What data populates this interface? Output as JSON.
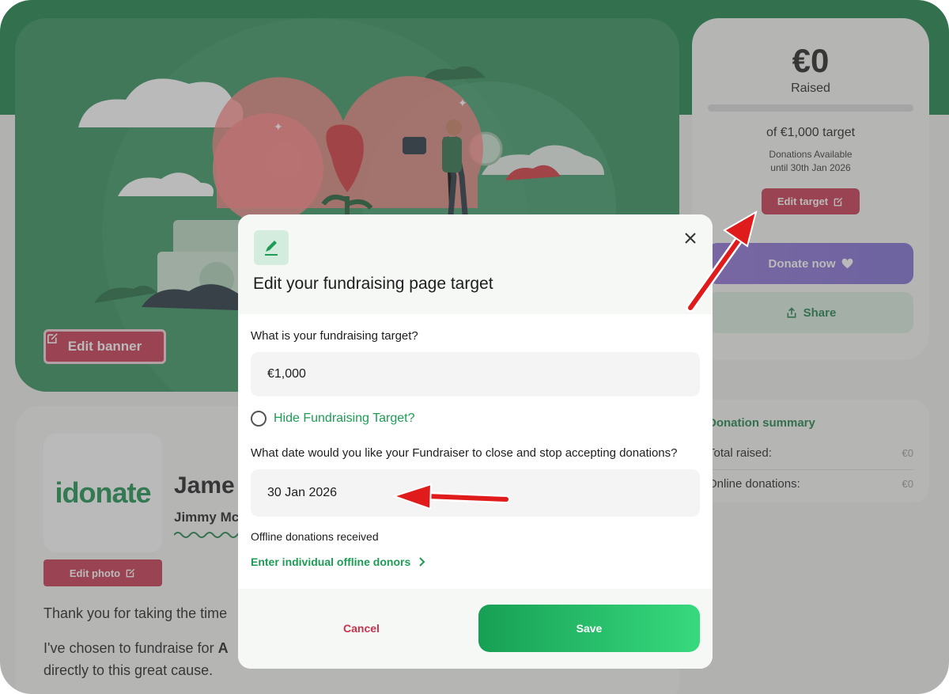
{
  "banner": {
    "edit_label": "Edit banner"
  },
  "sidebar": {
    "amount": "€0",
    "raised_label": "Raised",
    "progress_fraction": 0,
    "target_text": "of €1,000 target",
    "availability_line1": "Donations Available",
    "availability_line2": "until 30th Jan 2026",
    "edit_target_label": "Edit target",
    "donate_label": "Donate now",
    "share_label": "Share"
  },
  "summary": {
    "title": "Donation summary",
    "rows": [
      {
        "label": "Total raised:",
        "value": "€0"
      },
      {
        "label": "Online donations:",
        "value": "€0"
      }
    ]
  },
  "profile": {
    "logo_text": "idonate",
    "edit_photo_label": "Edit photo",
    "name": "Jame",
    "username": "Jimmy Mc",
    "paragraph1": "Thank you for taking the time",
    "paragraph2_start": "I've chosen to fundraise for ",
    "paragraph2_bold": "A",
    "paragraph3": "directly to this great cause."
  },
  "modal": {
    "title": "Edit your fundraising page target",
    "target_question": "What is your fundraising target?",
    "target_value": "€1,000",
    "hide_target_label": "Hide Fundraising Target?",
    "date_question": "What date would you like your Fundraiser to close and stop accepting donations?",
    "date_value": "30 Jan 2026",
    "offline_label": "Offline donations received",
    "offline_link": "Enter individual offline donors",
    "cancel_label": "Cancel",
    "save_label": "Save"
  },
  "colors": {
    "brand_green": "#178044",
    "accent_red": "#c8334c",
    "donate_purple": "#8e6fd6",
    "link_green": "#1e9b55"
  },
  "icons": [
    "edit-external-icon",
    "heart-icon",
    "share-icon",
    "pencil-icon",
    "close-icon",
    "chevron-right-icon",
    "annotation-arrow"
  ]
}
